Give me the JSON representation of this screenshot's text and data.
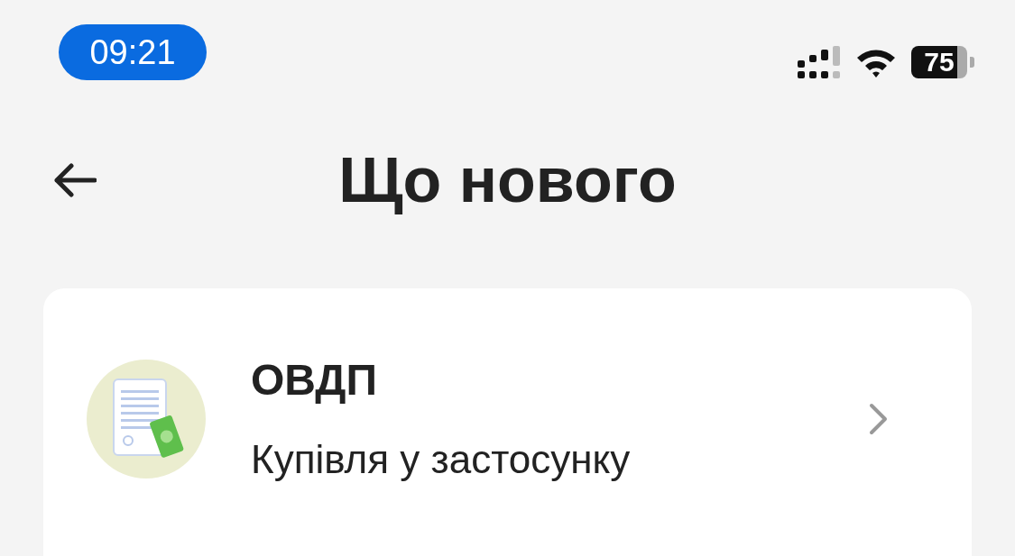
{
  "status_bar": {
    "time": "09:21",
    "battery": "75"
  },
  "header": {
    "title": "Що нового"
  },
  "items": [
    {
      "title": "ОВДП",
      "subtitle": "Купівля у застосунку"
    }
  ]
}
